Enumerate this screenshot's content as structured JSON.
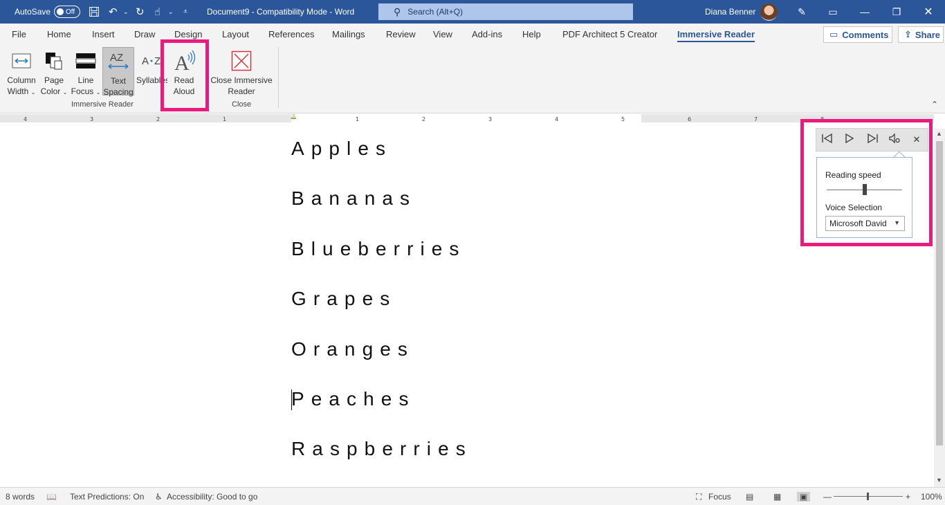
{
  "titlebar": {
    "autosave_label": "AutoSave",
    "autosave_state": "Off",
    "document_title": "Document9  -  Compatibility Mode  -  Word",
    "search_placeholder": "Search (Alt+Q)",
    "user_name": "Diana Benner"
  },
  "tabs": [
    {
      "label": "File"
    },
    {
      "label": "Home"
    },
    {
      "label": "Insert"
    },
    {
      "label": "Draw"
    },
    {
      "label": "Design"
    },
    {
      "label": "Layout"
    },
    {
      "label": "References"
    },
    {
      "label": "Mailings"
    },
    {
      "label": "Review"
    },
    {
      "label": "View"
    },
    {
      "label": "Add-ins"
    },
    {
      "label": "Help"
    },
    {
      "label": "PDF Architect 5 Creator"
    },
    {
      "label": "Immersive Reader",
      "active": true
    }
  ],
  "tab_actions": {
    "comments": "Comments",
    "share": "Share"
  },
  "ribbon": {
    "buttons": [
      {
        "line1": "Column",
        "line2": "Width",
        "dropdown": true
      },
      {
        "line1": "Page",
        "line2": "Color",
        "dropdown": true
      },
      {
        "line1": "Line",
        "line2": "Focus",
        "dropdown": true
      },
      {
        "line1": "Text",
        "line2": "Spacing",
        "selected": true
      },
      {
        "line1": "Syllables",
        "line2": ""
      },
      {
        "line1": "Read",
        "line2": "Aloud"
      },
      {
        "line1": "Close Immersive",
        "line2": "Reader"
      }
    ],
    "groups": {
      "immersive_reader": "Immersive Reader",
      "close": "Close"
    }
  },
  "ruler": {
    "labels": [
      "4",
      "3",
      "2",
      "1",
      "1",
      "1",
      "2",
      "3",
      "4",
      "5",
      "6",
      "7",
      "8"
    ]
  },
  "document": {
    "lines": [
      "Apples",
      "Bananas",
      "Blueberries",
      "Grapes",
      "Oranges",
      "Peaches",
      "Raspberries"
    ]
  },
  "read_aloud": {
    "reading_speed_label": "Reading speed",
    "reading_speed_value": 0.5,
    "voice_label": "Voice Selection",
    "voice_value": "Microsoft David"
  },
  "statusbar": {
    "word_count": "8 words",
    "text_predictions": "Text Predictions: On",
    "accessibility": "Accessibility: Good to go",
    "focus": "Focus",
    "zoom": "100%"
  },
  "colors": {
    "accent": "#2b579a",
    "highlight": "#ea1a7f"
  }
}
